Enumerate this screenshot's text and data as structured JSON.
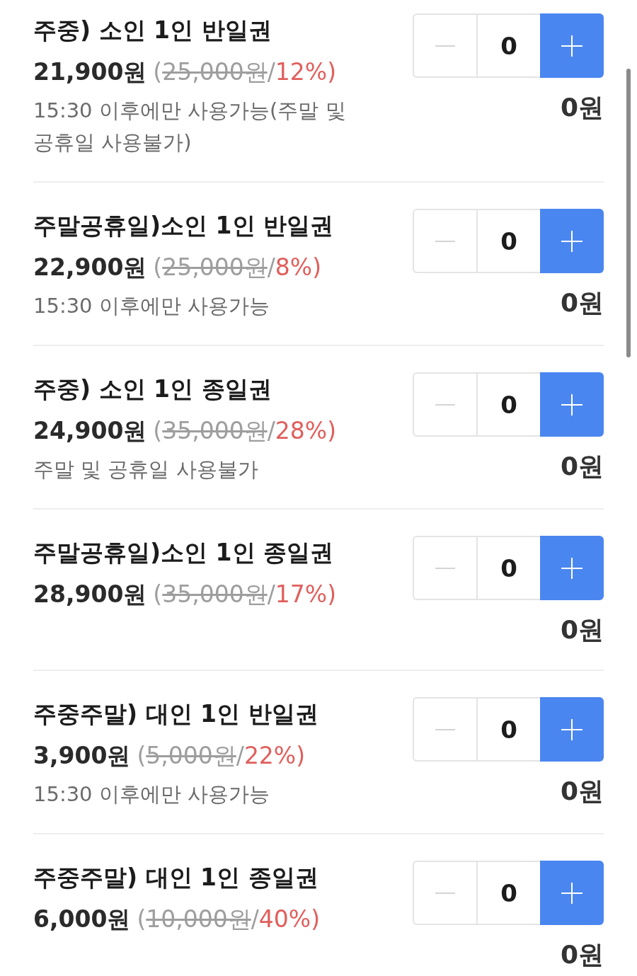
{
  "items": [
    {
      "title": "주중) 소인 1인 반일권",
      "price": "21,900원",
      "price_detail": [
        {
          "kind": "plain",
          "text": "("
        },
        {
          "kind": "struck",
          "text": "25,000원"
        },
        {
          "kind": "plain",
          "text": "/"
        },
        {
          "kind": "discount",
          "text": "12%)"
        }
      ],
      "notes": [
        "15:30 이후에만 사용가능(주말 및 공휴일 사용불가)"
      ],
      "minus_disabled": true,
      "quantity": "0",
      "total": "0원"
    },
    {
      "title": "주말공휴일)소인 1인 반일권",
      "price": "22,900원",
      "price_detail": [
        {
          "kind": "plain",
          "text": "("
        },
        {
          "kind": "struck",
          "text": "25,000원"
        },
        {
          "kind": "plain",
          "text": "/"
        },
        {
          "kind": "discount",
          "text": "8%)"
        }
      ],
      "notes": [
        "15:30 이후에만 사용가능"
      ],
      "minus_disabled": true,
      "quantity": "0",
      "total": "0원"
    },
    {
      "title": "주중) 소인 1인 종일권",
      "price": "24,900원",
      "price_detail": [
        {
          "kind": "plain",
          "text": "("
        },
        {
          "kind": "struck",
          "text": "35,000원"
        },
        {
          "kind": "plain",
          "text": "/"
        },
        {
          "kind": "discount",
          "text": "28%)"
        }
      ],
      "notes": [
        "주말 및 공휴일 사용불가"
      ],
      "minus_disabled": true,
      "quantity": "0",
      "total": "0원"
    },
    {
      "title": "주말공휴일)소인 1인 종일권",
      "price": "28,900원",
      "price_detail": [
        {
          "kind": "plain",
          "text": "("
        },
        {
          "kind": "struck",
          "text": "35,000원"
        },
        {
          "kind": "plain",
          "text": "/"
        },
        {
          "kind": "discount",
          "text": "17%)"
        }
      ],
      "minus_disabled": true,
      "quantity": "0",
      "total": "0원"
    },
    {
      "title": "주중주말) 대인 1인 반일권",
      "price": "3,900원",
      "price_detail": [
        {
          "kind": "plain",
          "text": "("
        },
        {
          "kind": "struck",
          "text": "5,000원"
        },
        {
          "kind": "plain",
          "text": "/"
        },
        {
          "kind": "discount",
          "text": "22%)"
        }
      ],
      "notes": [
        "15:30 이후에만 사용가능"
      ],
      "minus_disabled": true,
      "quantity": "0",
      "total": "0원"
    },
    {
      "title": "주중주말) 대인 1인 종일권",
      "price": "6,000원",
      "price_detail": [
        {
          "kind": "plain",
          "text": "("
        },
        {
          "kind": "struck",
          "text": "10,000원"
        },
        {
          "kind": "plain",
          "text": "/"
        },
        {
          "kind": "discount",
          "text": "40%)"
        }
      ],
      "minus_disabled": true,
      "quantity": "0",
      "total": "0원"
    }
  ]
}
